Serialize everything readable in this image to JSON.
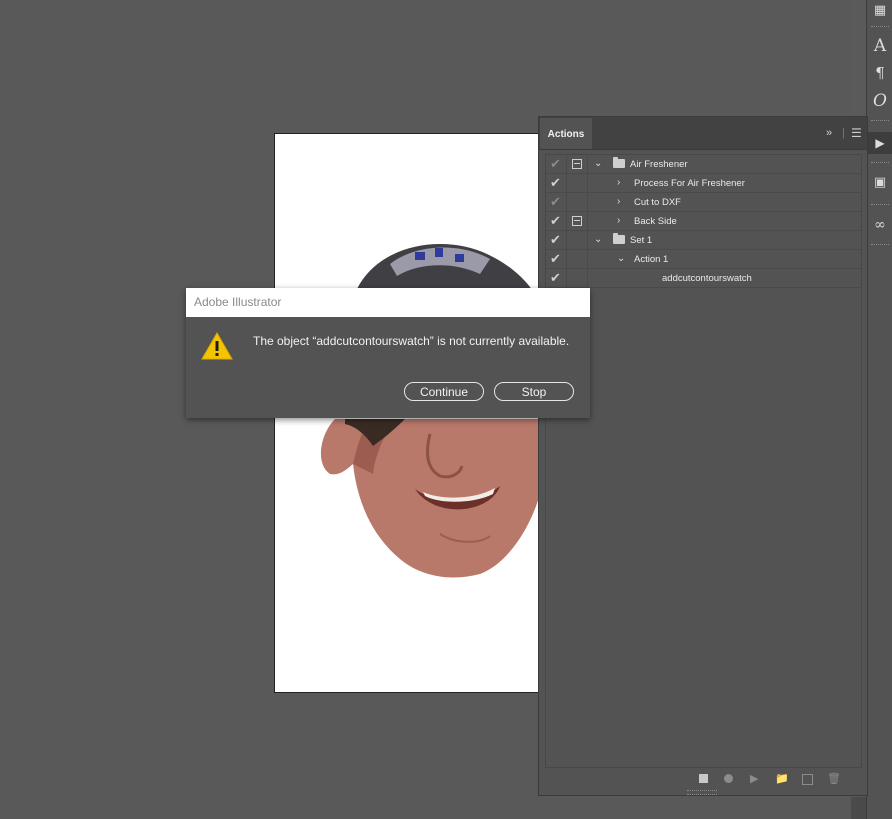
{
  "dialog": {
    "title": "Adobe Illustrator",
    "message": "The object “addcutcontourswatch” is not currently available.",
    "continue_label": "Continue",
    "stop_label": "Stop",
    "icon": "warning-icon"
  },
  "actions_panel": {
    "tab_label": "Actions",
    "rows": [
      {
        "label": "Air Freshener",
        "checked": true,
        "dim_check": true,
        "dialog_toggle": true,
        "expanded": true,
        "type": "set"
      },
      {
        "label": "Process For Air Freshener",
        "checked": true,
        "dim_check": false,
        "dialog_toggle": false,
        "expanded": false,
        "type": "action"
      },
      {
        "label": "Cut to DXF",
        "checked": true,
        "dim_check": true,
        "dialog_toggle": false,
        "expanded": false,
        "type": "action"
      },
      {
        "label": "Back Side",
        "checked": true,
        "dim_check": false,
        "dialog_toggle": true,
        "expanded": false,
        "type": "action"
      },
      {
        "label": "Set 1",
        "checked": true,
        "dim_check": false,
        "dialog_toggle": false,
        "expanded": true,
        "type": "set"
      },
      {
        "label": "Action 1",
        "checked": true,
        "dim_check": false,
        "dialog_toggle": false,
        "expanded": true,
        "type": "action"
      },
      {
        "label": "addcutcontourswatch",
        "checked": true,
        "dim_check": false,
        "dialog_toggle": false,
        "expanded": false,
        "type": "command"
      }
    ],
    "footer_icons": [
      "stop-icon",
      "record-icon",
      "play-icon",
      "new-set-icon",
      "new-action-icon",
      "delete-icon"
    ]
  },
  "colors": {
    "workspace": "#595959",
    "panel": "#535353",
    "warning": "#f5c400"
  }
}
